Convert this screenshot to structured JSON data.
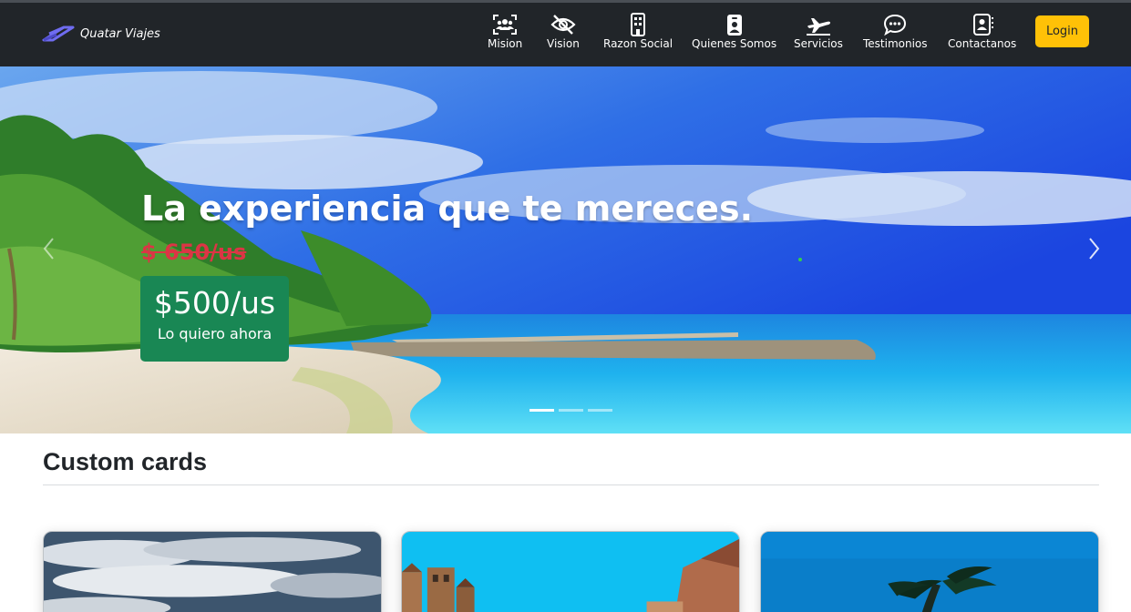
{
  "brand": {
    "name": "Quatar Viajes",
    "logo_color": "#6f6cf0"
  },
  "nav": {
    "items": [
      {
        "label": "Mision",
        "icon": "people-scan-icon"
      },
      {
        "label": "Vision",
        "icon": "eye-slash-icon"
      },
      {
        "label": "Razon Social",
        "icon": "building-icon"
      },
      {
        "label": "Quienes Somos",
        "icon": "person-badge-icon"
      },
      {
        "label": "Servicios",
        "icon": "airplane-icon"
      },
      {
        "label": "Testimonios",
        "icon": "chat-dots-icon"
      },
      {
        "label": "Contactanos",
        "icon": "person-lines-icon"
      }
    ],
    "login_label": "Login"
  },
  "hero": {
    "title": "La experiencia que te mereces.",
    "old_price": "$ 650/us",
    "new_price": "$500/us",
    "cta_label": "Lo quiero ahora",
    "slides": 3,
    "active_slide": 1
  },
  "section": {
    "title": "Custom cards"
  },
  "colors": {
    "navbar": "#212529",
    "accent": "#ffc107",
    "price_box": "#198754",
    "old_price": "#dc3545"
  }
}
